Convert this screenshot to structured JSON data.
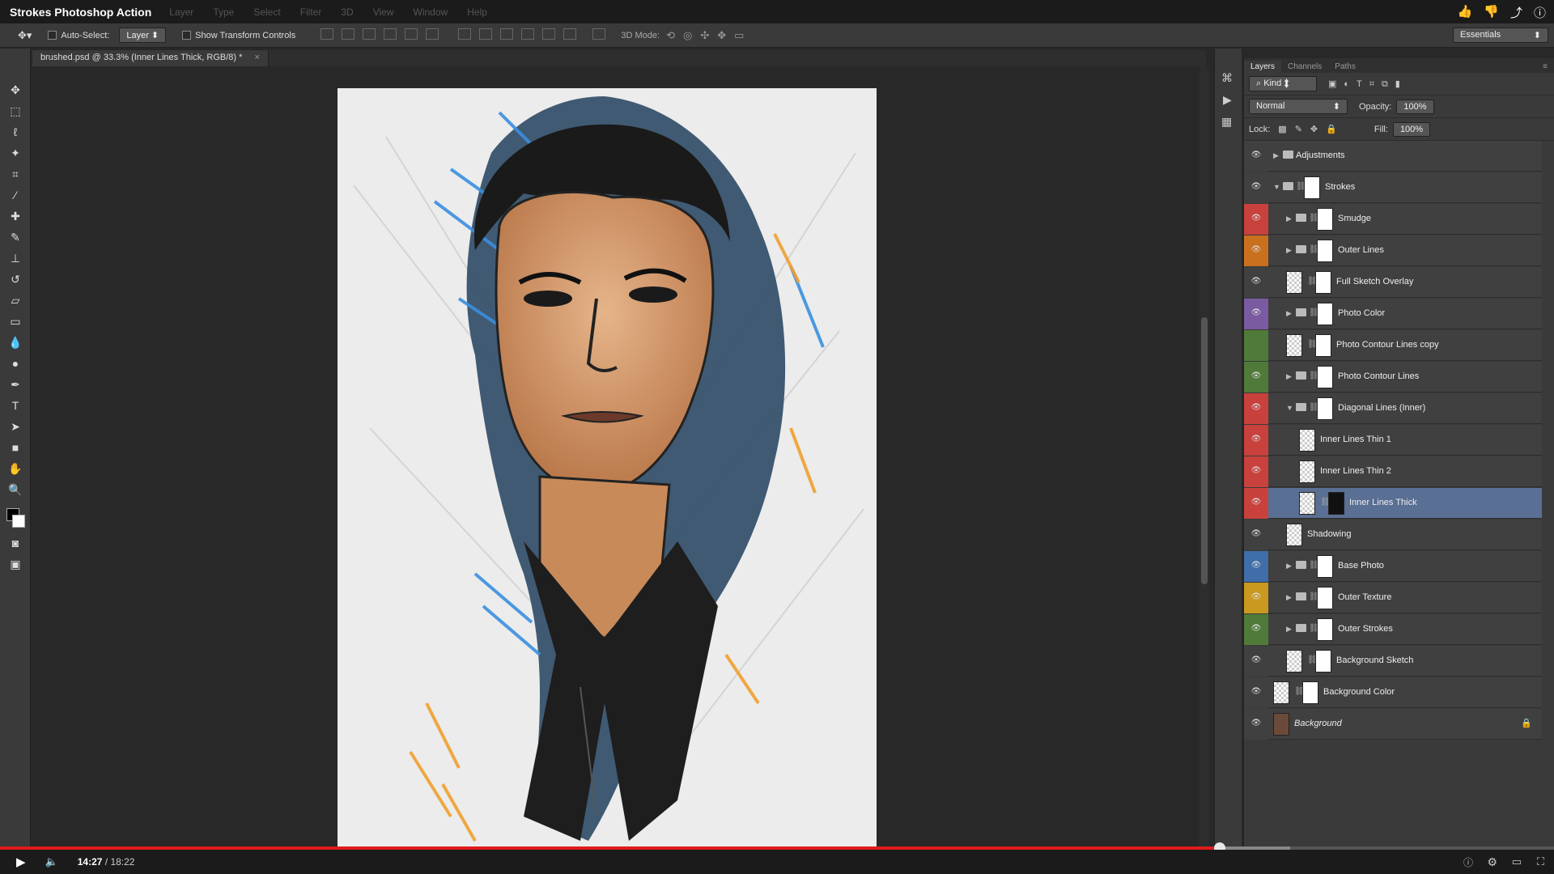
{
  "window": {
    "title": "Strokes Photoshop Action",
    "menu": [
      "Layer",
      "Type",
      "Select",
      "Filter",
      "3D",
      "View",
      "Window",
      "Help"
    ]
  },
  "options_bar": {
    "auto_select_label": "Auto-Select:",
    "auto_select_value": "Layer",
    "show_transform_label": "Show Transform Controls",
    "mode_3d_label": "3D Mode:",
    "workspace": "Essentials"
  },
  "document_tab": {
    "label": "brushed.psd @ 33.3% (Inner Lines Thick, RGB/8) *",
    "close": "×"
  },
  "layers_panel": {
    "tabs": [
      "Layers",
      "Channels",
      "Paths"
    ],
    "filter_kind": "Kind",
    "blend_mode": "Normal",
    "opacity_label": "Opacity:",
    "opacity_value": "100%",
    "lock_label": "Lock:",
    "fill_label": "Fill:",
    "fill_value": "100%",
    "layers": [
      {
        "name": "Adjustments",
        "color": "#404040",
        "type": "group",
        "expanded": false,
        "indent": 0
      },
      {
        "name": "Strokes",
        "color": "#404040",
        "type": "group",
        "expanded": true,
        "indent": 0
      },
      {
        "name": "Smudge",
        "color": "#c8413c",
        "type": "group",
        "expanded": false,
        "indent": 1
      },
      {
        "name": "Outer Lines",
        "color": "#c9701f",
        "type": "group",
        "expanded": false,
        "indent": 1
      },
      {
        "name": "Full Sketch Overlay",
        "color": "#404040",
        "type": "layer",
        "indent": 1
      },
      {
        "name": "Photo Color",
        "color": "#7a5aa0",
        "type": "group",
        "expanded": false,
        "indent": 1
      },
      {
        "name": "Photo Contour Lines copy",
        "color": "#4f7a3a",
        "type": "layer",
        "indent": 1,
        "hidden": true
      },
      {
        "name": "Photo Contour Lines",
        "color": "#4f7a3a",
        "type": "group",
        "expanded": false,
        "indent": 1
      },
      {
        "name": "Diagonal Lines (Inner)",
        "color": "#c8413c",
        "type": "group",
        "expanded": true,
        "indent": 1
      },
      {
        "name": "Inner Lines Thin 1",
        "color": "#c8413c",
        "type": "layer",
        "indent": 2
      },
      {
        "name": "Inner Lines Thin 2",
        "color": "#c8413c",
        "type": "layer",
        "indent": 2
      },
      {
        "name": "Inner Lines Thick",
        "color": "#c8413c",
        "type": "layer",
        "indent": 2,
        "selected": true
      },
      {
        "name": "Shadowing",
        "color": "#404040",
        "type": "layer",
        "indent": 1
      },
      {
        "name": "Base Photo",
        "color": "#3f6ea8",
        "type": "group",
        "expanded": false,
        "indent": 1
      },
      {
        "name": "Outer Texture",
        "color": "#c99a1f",
        "type": "group",
        "expanded": false,
        "indent": 1
      },
      {
        "name": "Outer Strokes",
        "color": "#4f7a3a",
        "type": "group",
        "expanded": false,
        "indent": 1
      },
      {
        "name": "Background Sketch",
        "color": "#404040",
        "type": "layer",
        "indent": 1
      },
      {
        "name": "Background Color",
        "color": "#404040",
        "type": "layer",
        "indent": 0
      },
      {
        "name": "Background",
        "color": "#404040",
        "type": "background",
        "indent": 0
      }
    ]
  },
  "player": {
    "current_time": "14:27",
    "separator": " / ",
    "duration": "18:22",
    "progress_fraction": 0.785,
    "loaded_fraction": 0.83
  }
}
